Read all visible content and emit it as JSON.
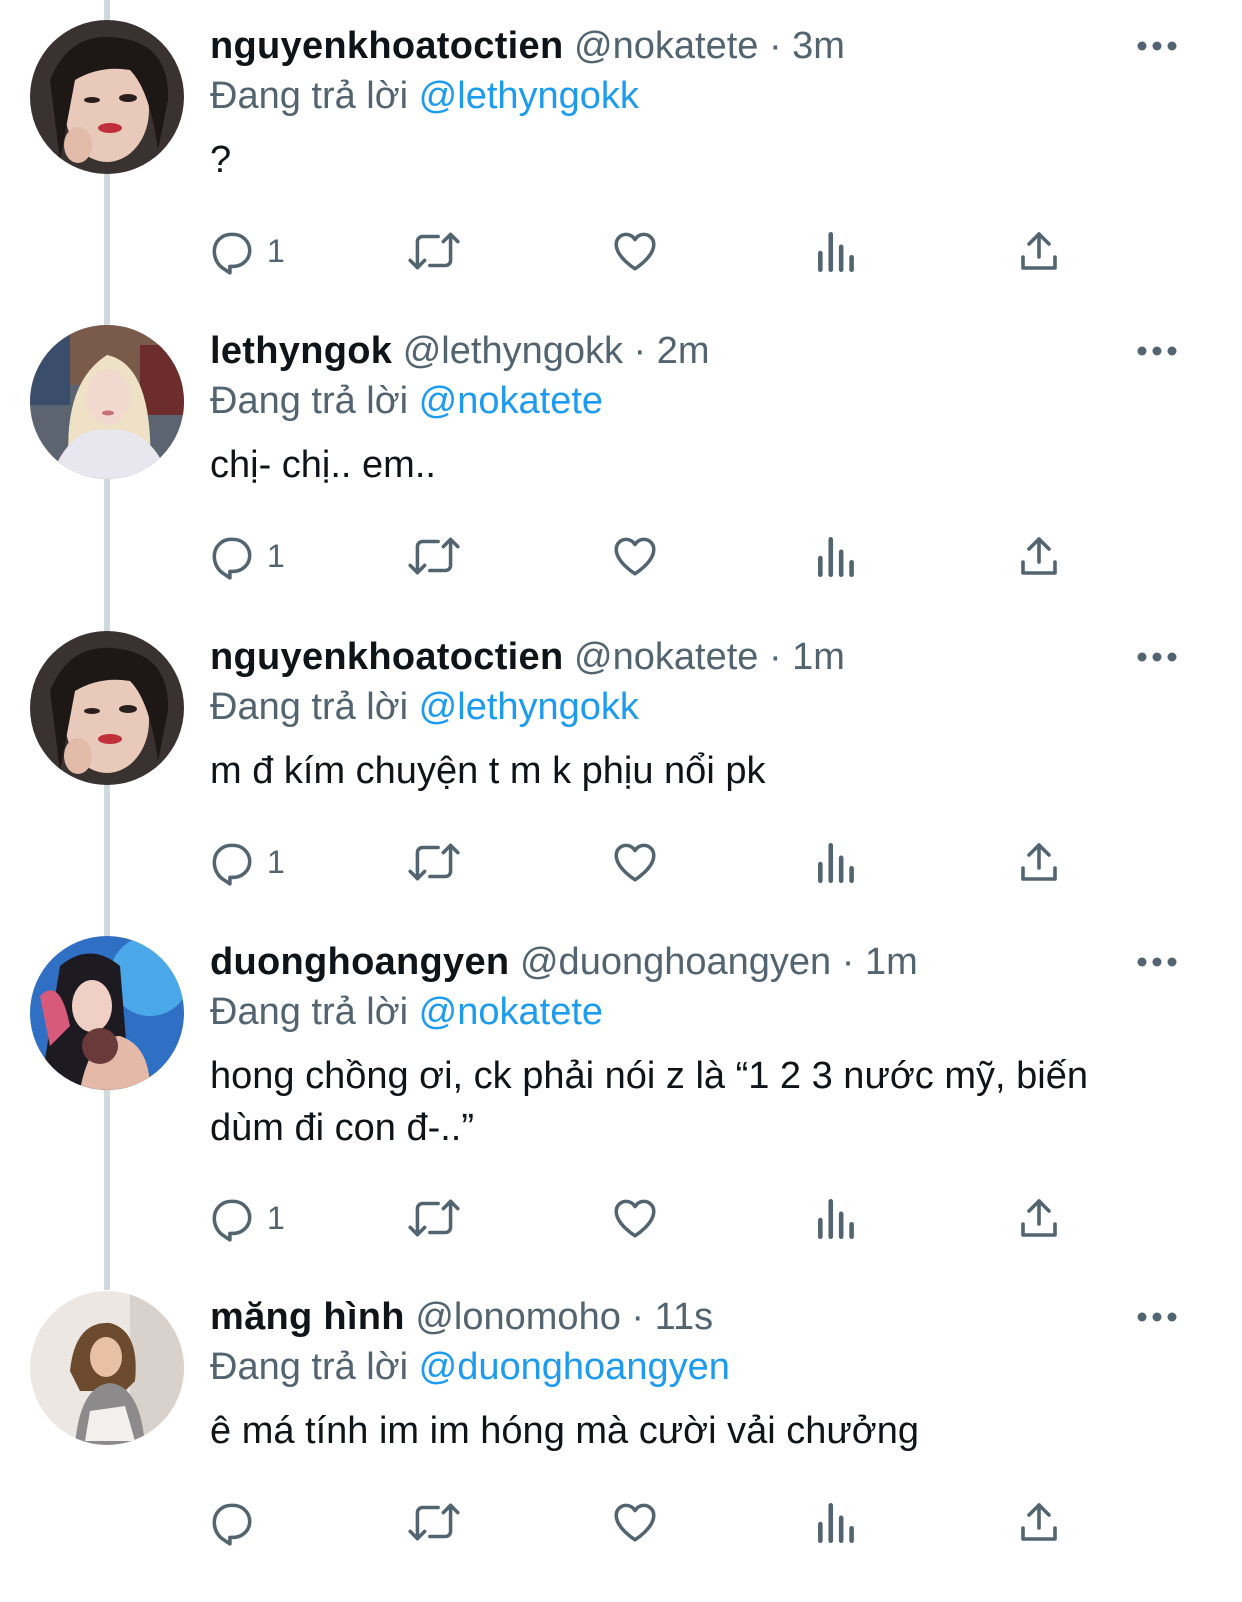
{
  "reply_prefix": "Đang trả lời",
  "colors": {
    "accent": "#1d9bf0",
    "text": "#0f1419",
    "secondary": "#536471",
    "thread_line": "#cfd9de"
  },
  "tweets": [
    {
      "name": "nguyenkhoatoctien",
      "handle": "@nokatete",
      "separator": "·",
      "time": "3m",
      "reply_to": "@lethyngokk",
      "text": "?",
      "reply_count": "1",
      "avatar": "avatar-woman-dark-hair"
    },
    {
      "name": "lethyngok",
      "handle": "@lethyngokk",
      "separator": "·",
      "time": "2m",
      "reply_to": "@nokatete",
      "text": "chị- chị.. em..",
      "reply_count": "1",
      "avatar": "avatar-woman-blonde"
    },
    {
      "name": "nguyenkhoatoctien",
      "handle": "@nokatete",
      "separator": "·",
      "time": "1m",
      "reply_to": "@lethyngokk",
      "text": "m đ kím chuyện t m k phịu nổi pk",
      "reply_count": "1",
      "avatar": "avatar-woman-dark-hair"
    },
    {
      "name": "duonghoangyen",
      "handle": "@duonghoangyen",
      "separator": "·",
      "time": "1m",
      "reply_to": "@nokatete",
      "text": "hong chồng ơi, ck phải nói z là “1 2 3 nước mỹ, biến dùm đi con đ-..”",
      "reply_count": "1",
      "avatar": "avatar-woman-blue-backdrop"
    },
    {
      "name": "măng hình",
      "handle": "@lonomoho",
      "separator": "·",
      "time": "11s",
      "reply_to": "@duonghoangyen",
      "text": "ê má tính im im hóng mà cười vải chưởng",
      "reply_count": "",
      "avatar": "avatar-woman-sitting"
    }
  ]
}
